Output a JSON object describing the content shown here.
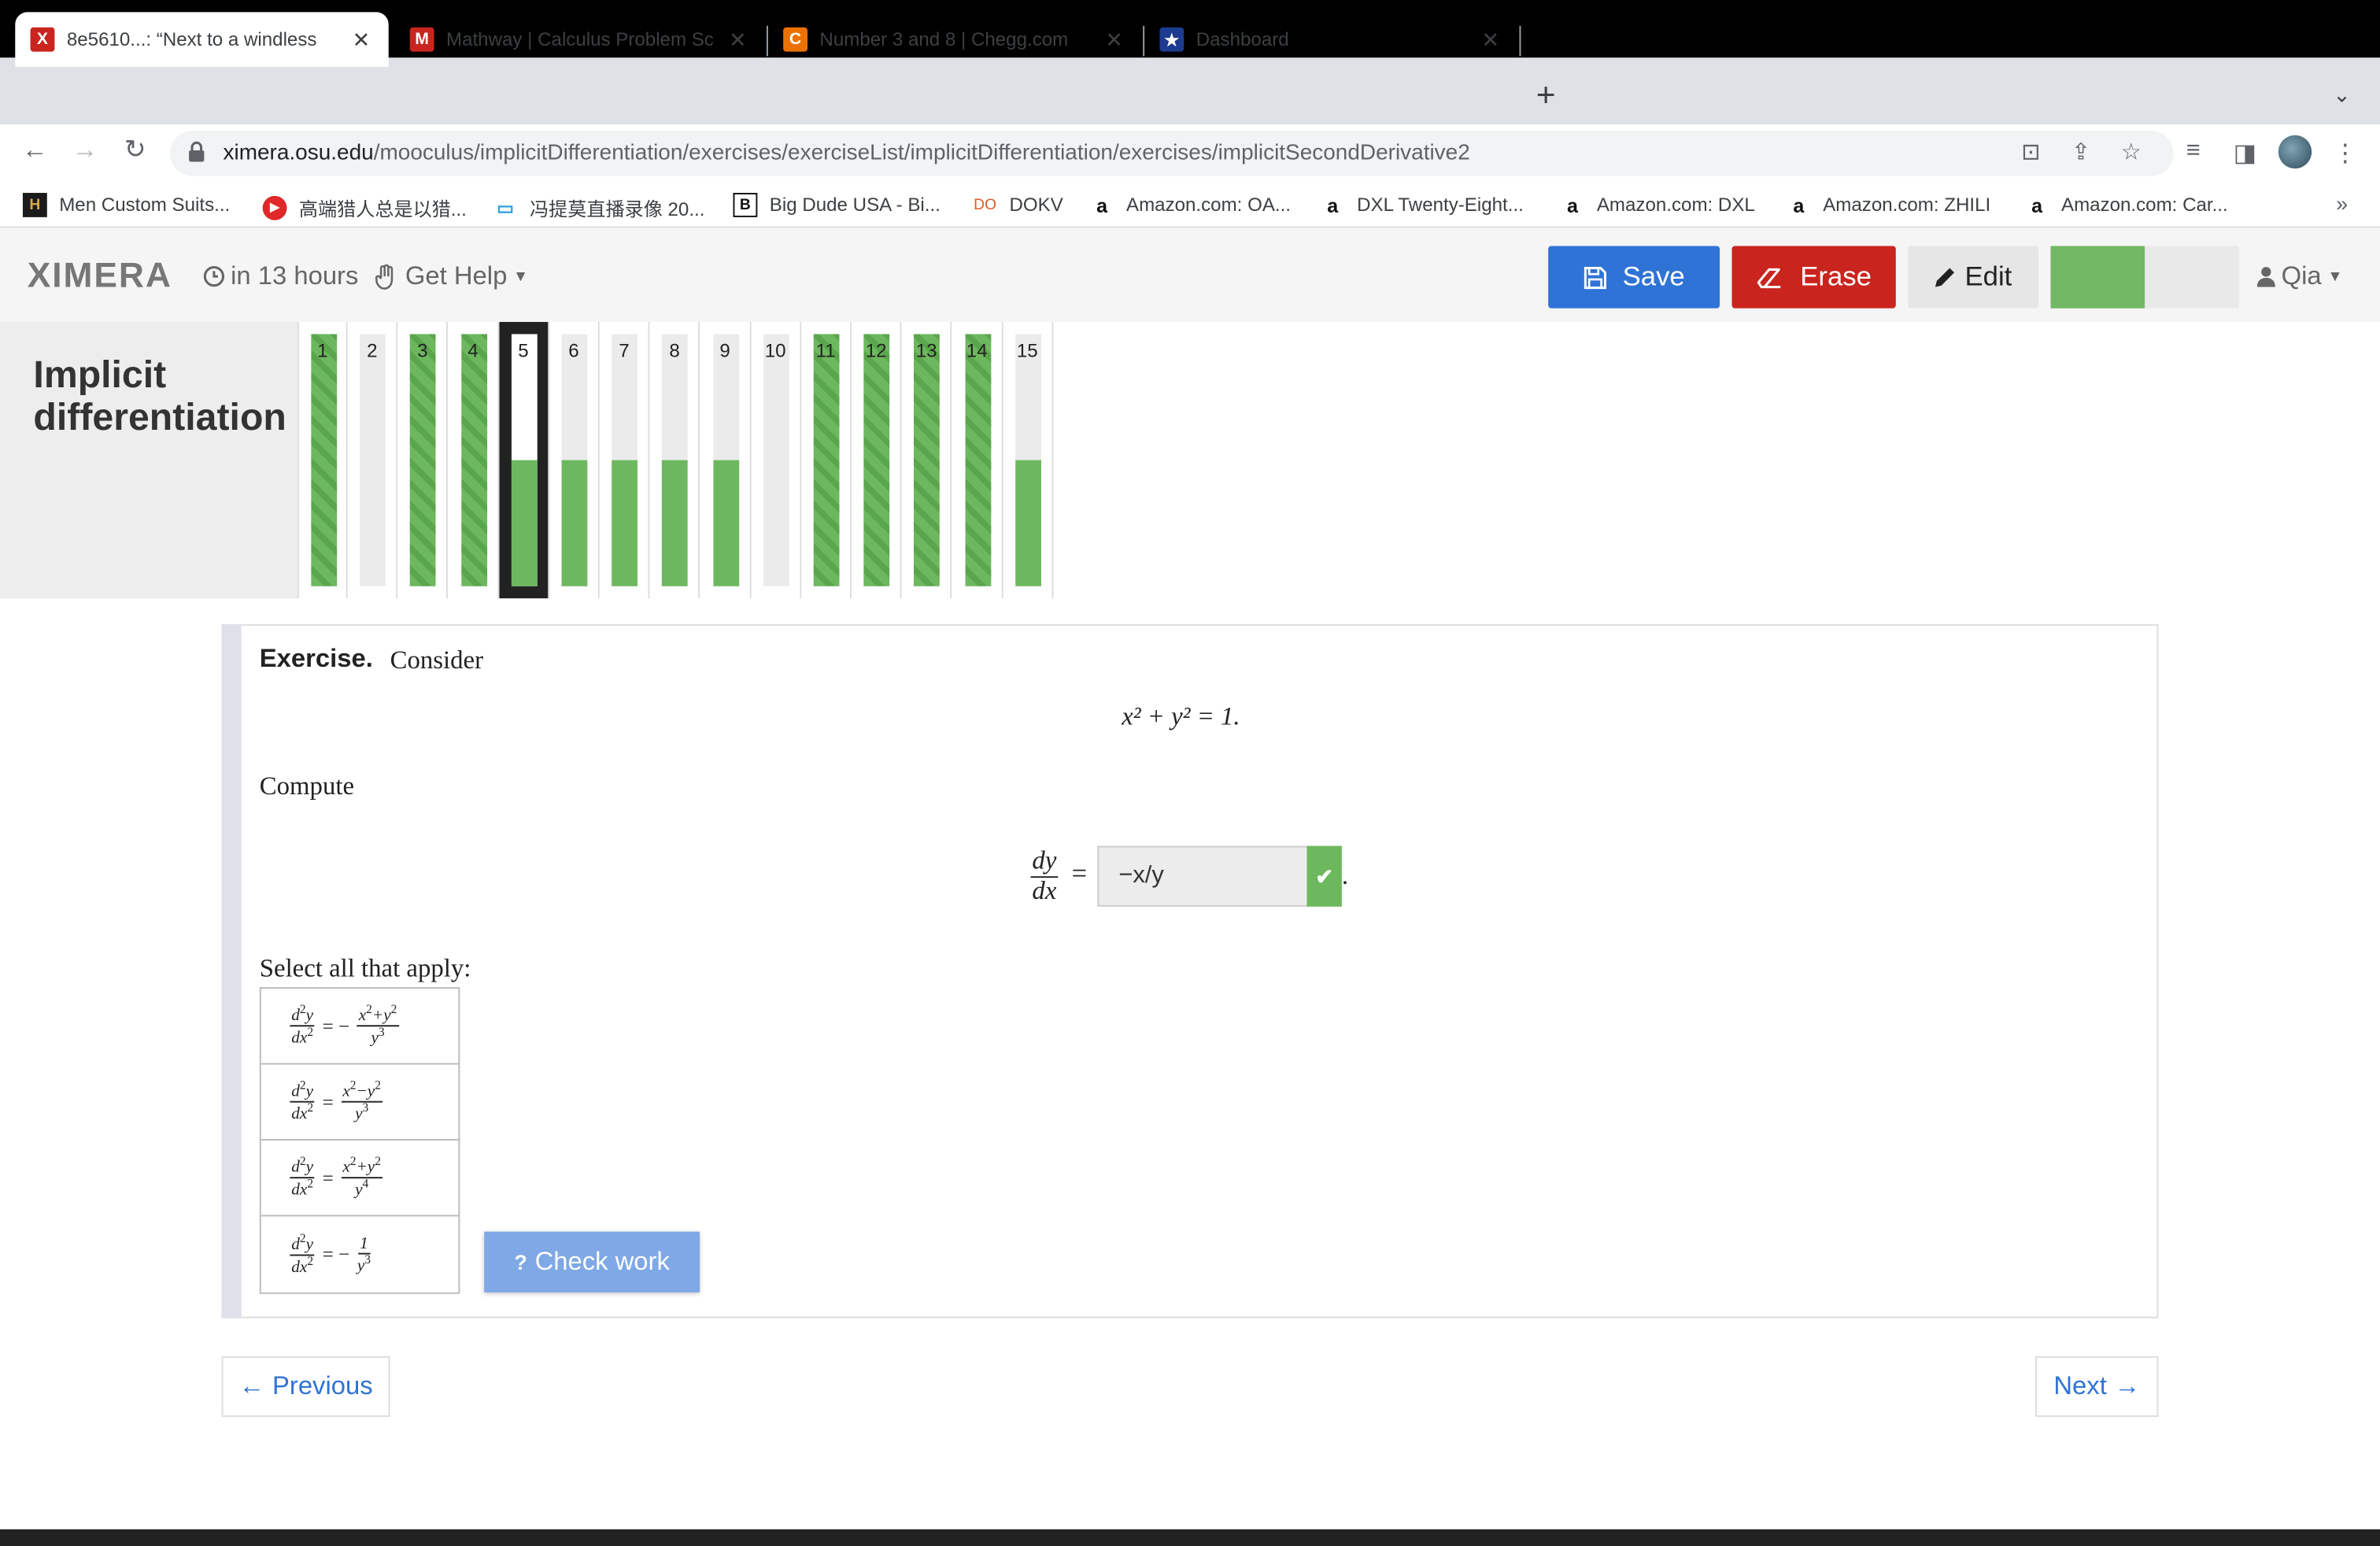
{
  "browser": {
    "tabs": [
      {
        "title": "8e5610...: “Next to a windless",
        "favicon": "X",
        "favicon_color": "#c9251e",
        "active": true
      },
      {
        "title": "Mathway | Calculus Problem Sc",
        "favicon": "M",
        "favicon_color": "#c9251e",
        "active": false
      },
      {
        "title": "Number 3 and 8  | Chegg.com",
        "favicon": "C",
        "favicon_color": "#eb7100",
        "active": false
      },
      {
        "title": "Dashboard",
        "favicon": "★",
        "favicon_color": "#1d3b8f",
        "active": false
      }
    ],
    "url_domain": "ximera.osu.edu",
    "url_path": "/mooculus/implicitDifferentiation/exercises/exerciseList/implicitDifferentiation/exercises/implicitSecondDerivative2",
    "bookmarks": [
      {
        "label": "Men Custom Suits...",
        "icon": "H"
      },
      {
        "label": "高端猎人总是以猎...",
        "icon": "▶"
      },
      {
        "label": "冯提莫直播录像 20...",
        "icon": "tv"
      },
      {
        "label": "Big Dude USA - Bi...",
        "icon": "B"
      },
      {
        "label": "DOKV",
        "icon": "DO"
      },
      {
        "label": "Amazon.com: OA...",
        "icon": "a"
      },
      {
        "label": "DXL Twenty-Eight...",
        "icon": "a"
      },
      {
        "label": "Amazon.com: DXL",
        "icon": "a"
      },
      {
        "label": "Amazon.com: ZHILI",
        "icon": "a"
      },
      {
        "label": "Amazon.com: Car...",
        "icon": "a"
      }
    ]
  },
  "header": {
    "logo": "XIMERA",
    "due": "in 13 hours",
    "get_help": "Get Help",
    "save": "Save",
    "erase": "Erase",
    "edit": "Edit",
    "user": "Qia",
    "progress_fraction": 0.5
  },
  "activity": {
    "title": "Implicit differentiation",
    "current": 5,
    "problems": [
      {
        "n": "1",
        "fill": 1.0,
        "complete": true
      },
      {
        "n": "2",
        "fill": 0.0,
        "complete": false
      },
      {
        "n": "3",
        "fill": 1.0,
        "complete": true
      },
      {
        "n": "4",
        "fill": 1.0,
        "complete": true
      },
      {
        "n": "5",
        "fill": 0.5,
        "complete": false
      },
      {
        "n": "6",
        "fill": 0.5,
        "complete": false
      },
      {
        "n": "7",
        "fill": 0.5,
        "complete": false
      },
      {
        "n": "8",
        "fill": 0.5,
        "complete": false
      },
      {
        "n": "9",
        "fill": 0.5,
        "complete": false
      },
      {
        "n": "10",
        "fill": 0.0,
        "complete": false
      },
      {
        "n": "11",
        "fill": 1.0,
        "complete": true
      },
      {
        "n": "12",
        "fill": 1.0,
        "complete": true
      },
      {
        "n": "13",
        "fill": 1.0,
        "complete": true
      },
      {
        "n": "14",
        "fill": 1.0,
        "complete": true
      },
      {
        "n": "15",
        "fill": 0.5,
        "complete": false
      }
    ]
  },
  "exercise": {
    "label": "Exercise.",
    "consider": "Consider",
    "equation": "x² + y² = 1.",
    "compute": "Compute",
    "answer_value": "−x/y",
    "select_label": "Select all that apply:",
    "check_work": "Check work"
  },
  "nav": {
    "previous": "Previous",
    "next": "Next"
  },
  "colors": {
    "save": "#2f73d6",
    "erase": "#c9251e",
    "progress_green": "#6db85e"
  }
}
